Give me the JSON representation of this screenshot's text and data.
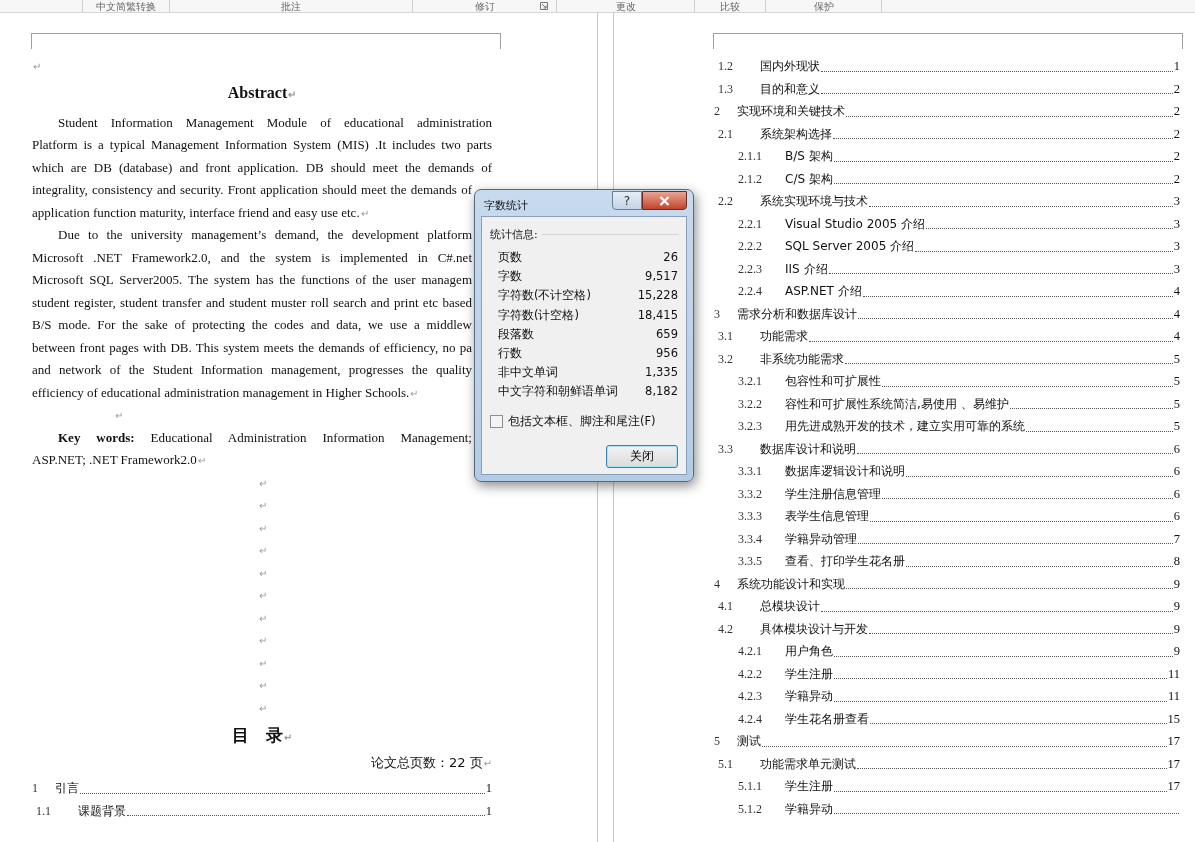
{
  "ribbon": {
    "groups": [
      {
        "label": "中文简繁转换",
        "launcher": false
      },
      {
        "label": "批注",
        "launcher": false
      },
      {
        "label": "修订",
        "launcher": true
      },
      {
        "label": "更改",
        "launcher": false
      },
      {
        "label": "比较",
        "launcher": false
      },
      {
        "label": "保护",
        "launcher": false
      }
    ]
  },
  "paragraph_mark": "↵",
  "left_page": {
    "blocks": [
      {
        "kind": "empty"
      },
      {
        "kind": "heading",
        "text": "Abstract"
      },
      {
        "kind": "text",
        "lines": [
          {
            "text": "Student Information Management Module of educational administration",
            "covered": false
          },
          {
            "text": "Platform is a typical Management Information System (MIS) .It includes two parts",
            "covered": false
          },
          {
            "text": "which are DB (database) and front application. DB should meet the demands of",
            "covered": false
          },
          {
            "text": "integrality, consistency and security. Front application should meet the demands of",
            "covered": true
          },
          {
            "text": "application function maturity, interface friend and easy use etc.",
            "covered": false
          }
        ]
      },
      {
        "kind": "text",
        "lines": [
          {
            "text": "Due to the university management’s demand, the development platform",
            "covered": true
          },
          {
            "text": "Microsoft .NET Framework2.0, and the system is implemented in C#.net",
            "covered": true
          },
          {
            "text": "Microsoft SQL Server2005. The system has the functions of the user managem",
            "covered": true
          },
          {
            "text": "student register, student transfer and student muster roll search and print etc based",
            "covered": true
          },
          {
            "text": "B/S mode. For the sake of protecting the codes and data, we use a middlew",
            "covered": true
          },
          {
            "text": "between front pages with DB. This system meets the demands of efficiency, no pa",
            "covered": true
          },
          {
            "text": "and network of the Student Information management, progresses the quality",
            "covered": true
          },
          {
            "text": "efficiency of educational administration management in Higher Schools.",
            "covered": false
          }
        ]
      },
      {
        "kind": "blank"
      },
      {
        "kind": "text",
        "lines": [
          {
            "text": "**Key words:** Educational Administration Information Management;",
            "covered": true
          },
          {
            "text": "ASP.NET; .NET Framework2.0",
            "covered": false
          }
        ]
      },
      {
        "kind": "centered"
      },
      {
        "kind": "centered"
      },
      {
        "kind": "centered"
      },
      {
        "kind": "centered"
      },
      {
        "kind": "centered"
      },
      {
        "kind": "centered"
      },
      {
        "kind": "centered"
      },
      {
        "kind": "centered"
      },
      {
        "kind": "centered"
      },
      {
        "kind": "centered"
      },
      {
        "kind": "centered"
      },
      {
        "kind": "toc_heading",
        "text": "目　录"
      },
      {
        "kind": "note",
        "text": "论文总页数：22 页"
      },
      {
        "kind": "toc",
        "entries": [
          {
            "num": "1",
            "title": "引言",
            "page": "1",
            "children": [
              {
                "num": "1.1",
                "title": "课题背景",
                "page": "1"
              }
            ]
          }
        ]
      }
    ]
  },
  "right_page": {
    "toc": [
      {
        "children": [
          {
            "num": "1.2",
            "title": "国内外现状",
            "page": "1"
          },
          {
            "num": "1.3",
            "title": "目的和意义",
            "page": "2"
          }
        ]
      },
      {
        "num": "2",
        "title": "实现环境和关键技术",
        "page": "2",
        "children": [
          {
            "num": "2.1",
            "title": "系统架构选择",
            "page": "2",
            "children": [
              {
                "num": "2.1.1",
                "title": "B/S 架构",
                "page": "2"
              },
              {
                "num": "2.1.2",
                "title": "C/S 架构",
                "page": "2"
              }
            ]
          },
          {
            "num": "2.2",
            "title": "系统实现环境与技术",
            "page": "3",
            "children": [
              {
                "num": "2.2.1",
                "title": "Visual Studio 2005 介绍",
                "page": "3"
              },
              {
                "num": "2.2.2",
                "title": "SQL Server 2005 介绍",
                "page": "3"
              },
              {
                "num": "2.2.3",
                "title": "IIS 介绍",
                "page": "3"
              },
              {
                "num": "2.2.4",
                "title": "ASP.NET 介绍",
                "page": "4"
              }
            ]
          }
        ]
      },
      {
        "num": "3",
        "title": "需求分析和数据库设计",
        "page": "4",
        "children": [
          {
            "num": "3.1",
            "title": "功能需求",
            "page": "4"
          },
          {
            "num": "3.2",
            "title": "非系统功能需求",
            "page": "5",
            "children": [
              {
                "num": "3.2.1",
                "title": "包容性和可扩展性",
                "page": "5"
              },
              {
                "num": "3.2.2",
                "title": "容性和可扩展性系统简洁,易使用 、易维护",
                "page": "5"
              },
              {
                "num": "3.2.3",
                "title": "用先进成熟开发的技术，建立实用可靠的系统",
                "page": "5"
              }
            ]
          },
          {
            "num": "3.3",
            "title": "数据库设计和说明",
            "page": "6",
            "children": [
              {
                "num": "3.3.1",
                "title": "数据库逻辑设计和说明",
                "page": "6"
              },
              {
                "num": "3.3.2",
                "title": "学生注册信息管理",
                "page": "6"
              },
              {
                "num": "3.3.3",
                "title": "表学生信息管理",
                "page": "6"
              },
              {
                "num": "3.3.4",
                "title": "学籍异动管理",
                "page": "7"
              },
              {
                "num": "3.3.5",
                "title": "查看、打印学生花名册",
                "page": "8"
              }
            ]
          }
        ]
      },
      {
        "num": "4",
        "title": "系统功能设计和实现",
        "page": "9",
        "children": [
          {
            "num": "4.1",
            "title": "总模块设计",
            "page": "9"
          },
          {
            "num": "4.2",
            "title": "具体模块设计与开发",
            "page": "9",
            "children": [
              {
                "num": "4.2.1",
                "title": "用户角色",
                "page": "9"
              },
              {
                "num": "4.2.2",
                "title": "学生注册",
                "page": "11"
              },
              {
                "num": "4.2.3",
                "title": "学籍异动",
                "page": "11"
              },
              {
                "num": "4.2.4",
                "title": "学生花名册查看",
                "page": "15"
              }
            ]
          }
        ]
      },
      {
        "num": "5",
        "title": "测试",
        "page": "17",
        "children": [
          {
            "num": "5.1",
            "title": "功能需求单元测试",
            "page": "17",
            "children": [
              {
                "num": "5.1.1",
                "title": "学生注册",
                "page": "17"
              },
              {
                "num": "5.1.2",
                "title": "学籍异动"
              }
            ]
          }
        ]
      }
    ]
  },
  "dialog": {
    "title": "字数统计",
    "help_button": "?",
    "group_label": "统计信息:",
    "stats": [
      {
        "label": "页数",
        "value": "26"
      },
      {
        "label": "字数",
        "value": "9,517"
      },
      {
        "label": "字符数(不计空格)",
        "value": "15,228"
      },
      {
        "label": "字符数(计空格)",
        "value": "18,415"
      },
      {
        "label": "段落数",
        "value": "659"
      },
      {
        "label": "行数",
        "value": "956"
      },
      {
        "label": "非中文单词",
        "value": "1,335"
      },
      {
        "label": "中文字符和朝鲜语单词",
        "value": "8,182"
      }
    ],
    "checkbox": {
      "label": "包括文本框、脚注和尾注(F)",
      "checked": false
    },
    "close_button": "关闭"
  }
}
